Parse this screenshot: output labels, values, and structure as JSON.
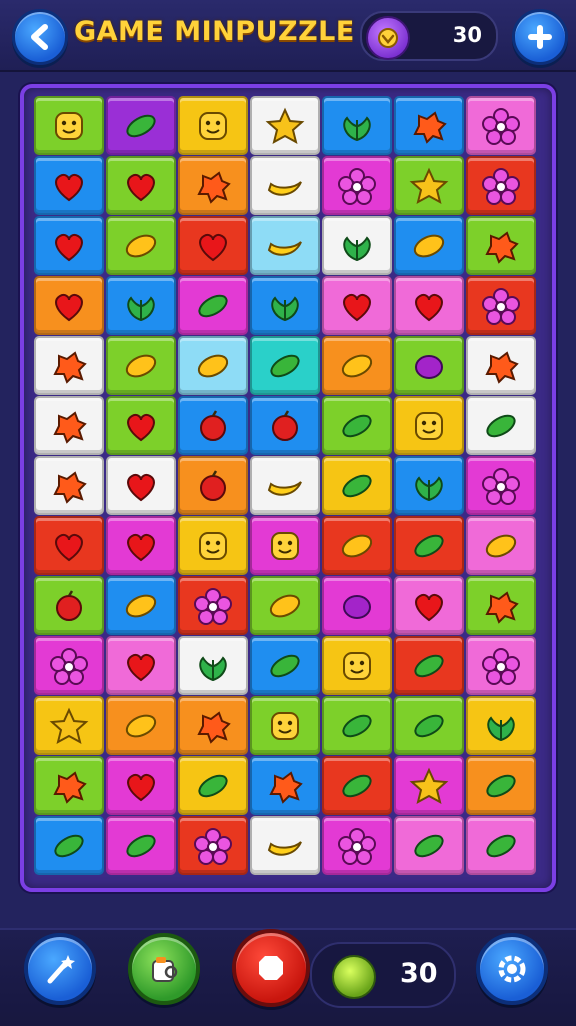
{
  "header": {
    "title": "GAME MINPUZZLE",
    "coins": "30",
    "back_icon": "back-arrow-icon",
    "coin_icon": "coin-icon",
    "add_icon": "plus-icon"
  },
  "bottom_bar": {
    "score": "30",
    "buttons": [
      "wand-icon",
      "cup-icon",
      "stop-icon",
      "settings-icon"
    ]
  },
  "palette": {
    "g": "#7dd02a",
    "p": "#9a2fd6",
    "y": "#f6c514",
    "w": "#f4f4f4",
    "b": "#1f8ef0",
    "r": "#e8371f",
    "k": "#f06ad8",
    "o": "#f7901e",
    "m": "#e33ad4",
    "s": "#8edcf6",
    "c": "#2ad0c9"
  },
  "board": {
    "rows": [
      [
        "g:face",
        "p:bean",
        "y:face",
        "w:star",
        "b:leaf",
        "b:splat",
        "k:flower"
      ],
      [
        "b:heart",
        "g:heart",
        "o:splat",
        "w:banana",
        "m:flower",
        "g:star",
        "r:flower"
      ],
      [
        "b:heart",
        "g:mango",
        "r:heart",
        "s:banana",
        "w:leaf",
        "b:mango",
        "g:splat"
      ],
      [
        "o:heart",
        "b:leaf",
        "m:bean",
        "b:leaf",
        "k:heart",
        "k:heart",
        "r:flower"
      ],
      [
        "w:splat",
        "g:mango",
        "s:mango",
        "c:bean",
        "o:mango",
        "g:plum",
        "w:splat"
      ],
      [
        "w:splat",
        "g:heart",
        "b:apple",
        "b:apple",
        "g:bean",
        "y:face",
        "w:bean"
      ],
      [
        "w:splat",
        "w:heart",
        "o:apple",
        "w:banana",
        "y:bean",
        "b:leaf",
        "m:flower"
      ],
      [
        "r:heart",
        "m:heart",
        "y:face",
        "m:face",
        "r:mango",
        "r:bean",
        "k:mango"
      ],
      [
        "g:apple",
        "b:mango",
        "r:flower",
        "g:mango",
        "m:plum",
        "k:heart",
        "g:splat"
      ],
      [
        "m:flower",
        "k:heart",
        "w:leaf",
        "b:bean",
        "y:face",
        "r:bean",
        "k:flower"
      ],
      [
        "y:star",
        "o:mango",
        "o:splat",
        "g:face",
        "g:bean",
        "g:bean",
        "y:leaf"
      ],
      [
        "g:splat",
        "m:heart",
        "y:bean",
        "b:splat",
        "r:bean",
        "m:star",
        "o:bean"
      ],
      [
        "b:bean",
        "m:bean",
        "r:flower",
        "w:banana",
        "m:flower",
        "k:bean",
        "k:bean"
      ]
    ]
  }
}
